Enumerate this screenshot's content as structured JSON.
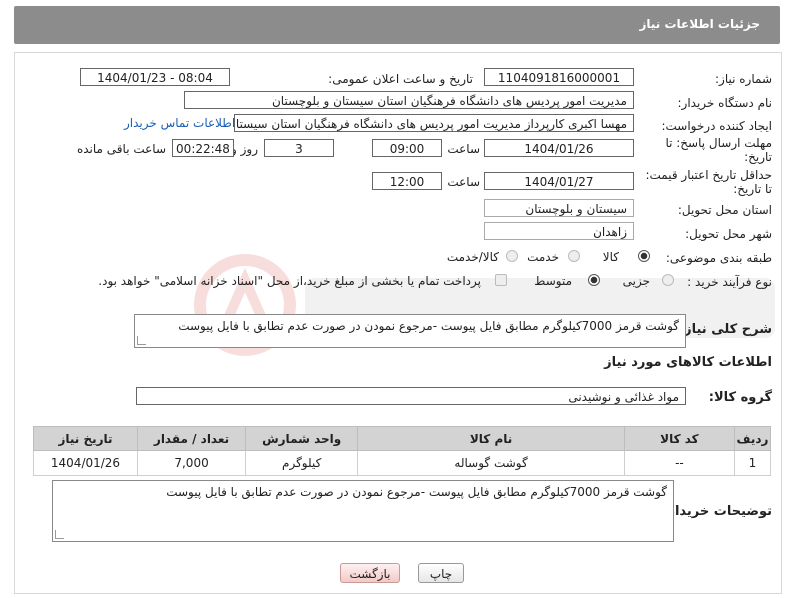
{
  "header": {
    "title": "جزئیات اطلاعات نیاز"
  },
  "form": {
    "need_number_label": "شماره نیاز:",
    "need_number": "1104091816000001",
    "announce_label": "تاریخ و ساعت اعلان عمومی:",
    "announce_value": "1404/01/23 - 08:04",
    "buyer_org_label": "نام دستگاه خریدار:",
    "buyer_org": "مدیریت امور پردیس های دانشگاه فرهنگیان استان سیستان و بلوچستان",
    "creator_label": "ایجاد کننده درخواست:",
    "creator": "مهسا اکبری کارپرداز مدیریت امور پردیس های دانشگاه فرهنگیان استان سیستان",
    "contact_link": "اطلاعات تماس خریدار",
    "reply_deadline_label_1": "مهلت ارسال پاسخ: تا",
    "reply_deadline_label_2": "تاریخ:",
    "reply_date": "1404/01/26",
    "time_label": "ساعت",
    "reply_time": "09:00",
    "days_value": "3",
    "days_label": "روز و",
    "remaining_time": "00:22:48",
    "remaining_label": "ساعت باقی مانده",
    "price_deadline_label_1": "حداقل تاریخ اعتبار قیمت:",
    "price_deadline_label_2": "تا تاریخ:",
    "price_date": "1404/01/27",
    "price_time": "12:00",
    "province_label": "استان محل تحویل:",
    "province": "سیستان و بلوچستان",
    "city_label": "شهر محل تحویل:",
    "city": "زاهدان",
    "category_label": "طبقه بندی موضوعی:",
    "category_options": [
      "کالا",
      "خدمت",
      "کالا/خدمت"
    ],
    "process_label": "نوع فرآیند خرید :",
    "process_options": [
      "جزیی",
      "متوسط"
    ],
    "payment_note": "پرداخت تمام یا بخشی از مبلغ خرید،از محل \"اسناد خزانه اسلامی\" خواهد بود.",
    "description_label": "شرح کلی نیاز:",
    "description": "گوشت قرمز 7000کیلوگرم مطابق فایل پیوست -مرجوع نمودن در صورت عدم تطابق با فایل پیوست"
  },
  "goods": {
    "section_title": "اطلاعات کالاهای مورد نیاز",
    "group_label": "گروه کالا:",
    "group_value": "مواد غذائی و نوشیدنی",
    "columns": [
      "ردیف",
      "کد کالا",
      "نام کالا",
      "واحد شمارش",
      "تعداد / مقدار",
      "تاریخ نیاز"
    ],
    "rows": [
      [
        "1",
        "--",
        "گوشت گوساله",
        "کیلوگرم",
        "7,000",
        "1404/01/26"
      ]
    ],
    "buyer_notes_label": "توضیحات خریدار:",
    "buyer_notes": "گوشت قرمز 7000کیلوگرم مطابق فایل پیوست -مرجوع نمودن در صورت عدم تطابق با فایل پیوست"
  },
  "buttons": {
    "print": "چاپ",
    "back": "بازگشت"
  },
  "colors": {
    "header_bg": "#8c8c8c",
    "table_header_bg": "#d3d3d3",
    "link": "#1a5fb4",
    "back_button": "#f2c9c9"
  }
}
